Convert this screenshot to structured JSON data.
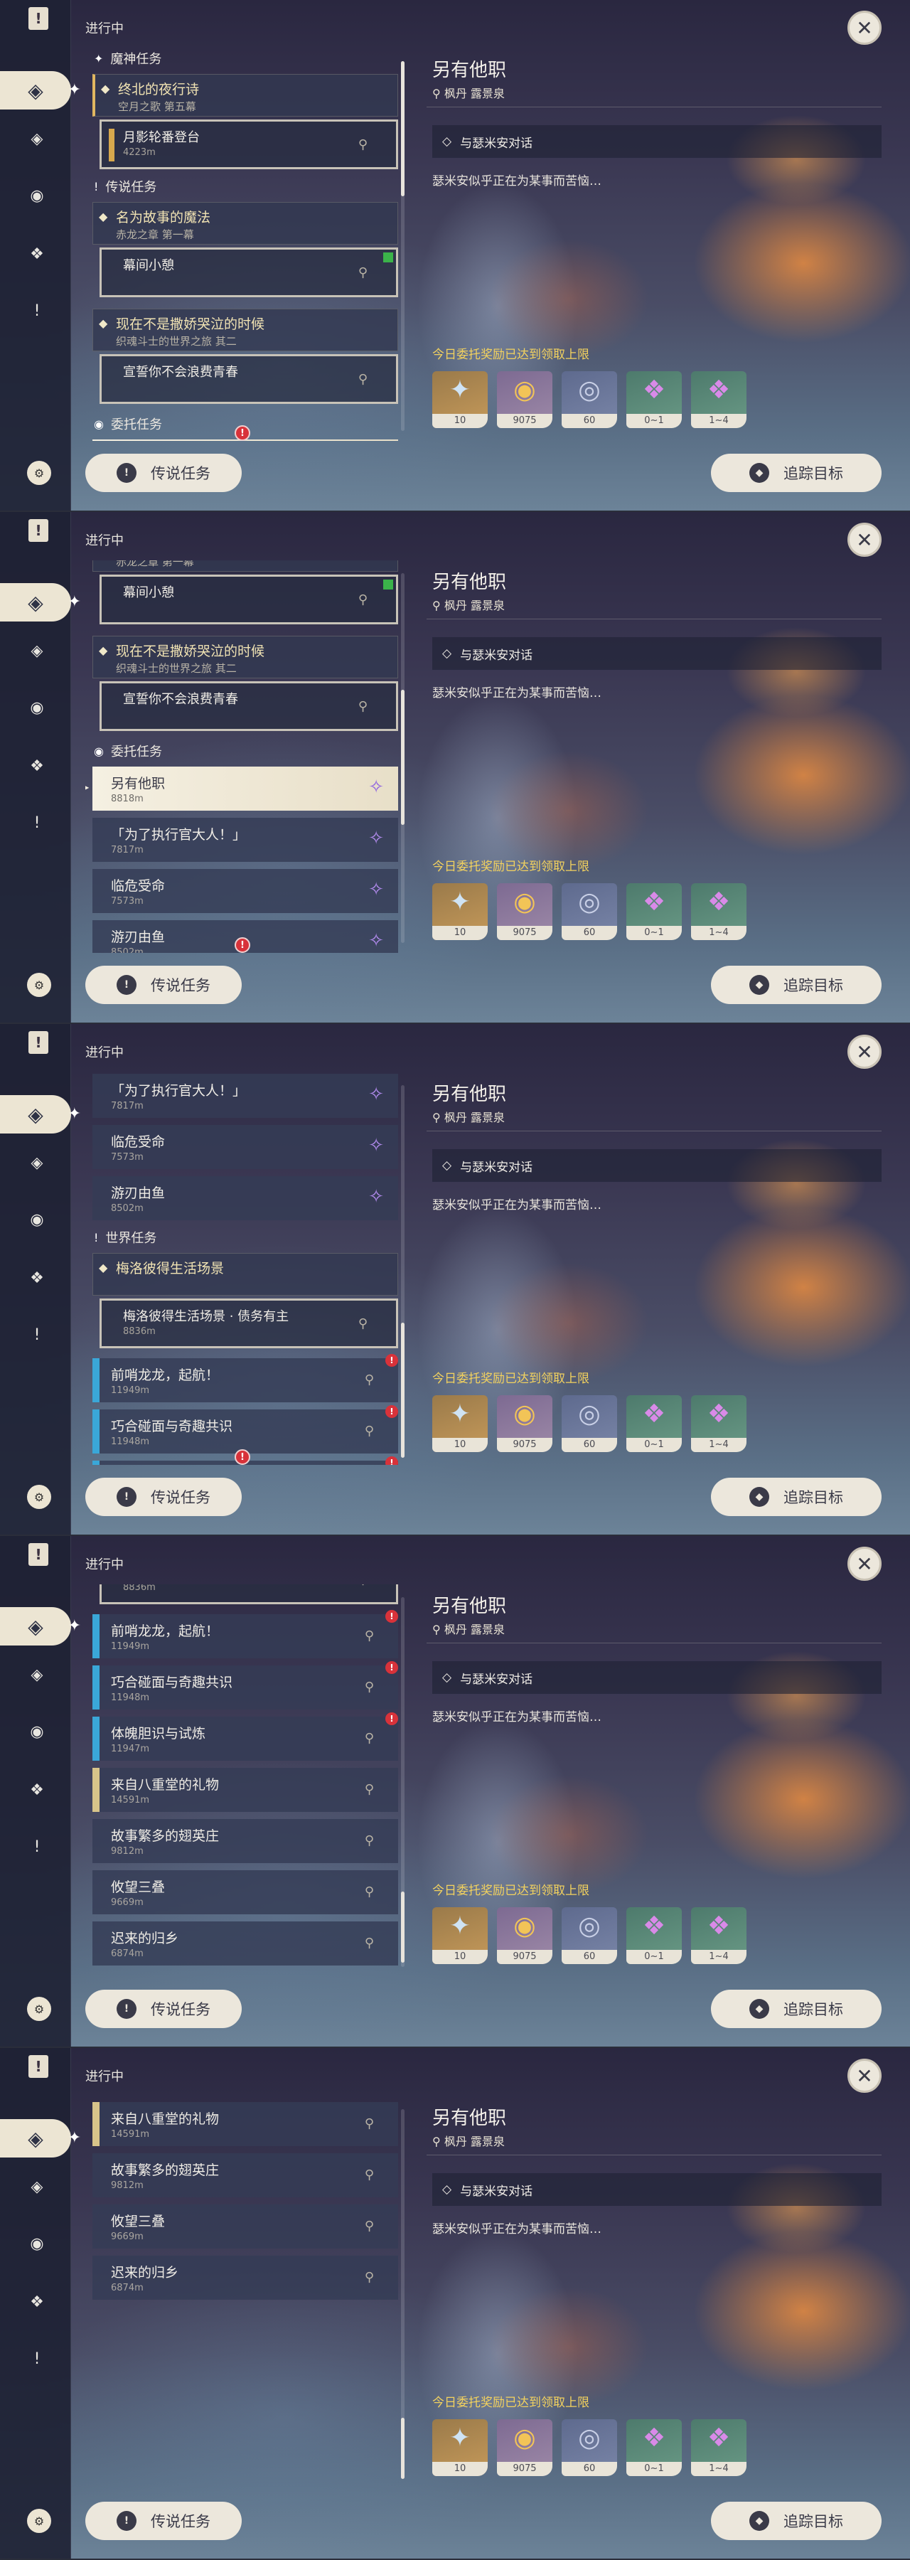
{
  "header": "进行中",
  "close_icon": "close-icon",
  "sections": {
    "archon": "魔神任务",
    "legend": "传说任务",
    "commission": "委托任务",
    "world": "世界任务"
  },
  "quests": {
    "archon_title": "终北的夜行诗",
    "archon_sub": "空月之歌 第五幕",
    "archon_step": "月影轮番登台",
    "archon_step_dist": "4223m",
    "legend1_title": "名为故事的魔法",
    "legend1_sub": "赤龙之章 第一幕",
    "legend1_step": "幕间小憩",
    "legend2_title": "现在不是撒娇哭泣的时候",
    "legend2_sub": "织魂斗士的世界之旅 其二",
    "legend2_step": "宣誓你不会浪费青春",
    "world_title": "梅洛彼得生活场景",
    "world_step": "梅洛彼得生活场景 · 债务有主",
    "world_step_dist": "8836m"
  },
  "commissions": [
    {
      "title": "另有他职",
      "dist": "8818m"
    },
    {
      "title": "「为了执行官大人！」",
      "dist": "7817m"
    },
    {
      "title": "临危受命",
      "dist": "7573m"
    },
    {
      "title": "游刃由鱼",
      "dist": "8502m"
    }
  ],
  "world_quests": [
    {
      "title": "前哨龙龙，起航！",
      "dist": "11949m"
    },
    {
      "title": "巧合碰面与奇趣共识",
      "dist": "11948m"
    },
    {
      "title": "体魄胆识与试炼",
      "dist": "11947m"
    },
    {
      "title": "来自八重堂的礼物",
      "dist": "14591m"
    },
    {
      "title": "故事繁多的翅英庄",
      "dist": "9812m"
    },
    {
      "title": "攸望三叠",
      "dist": "9669m"
    },
    {
      "title": "迟来的归乡",
      "dist": "6874m"
    }
  ],
  "detail": {
    "title": "另有他职",
    "location": "枫丹 露景泉",
    "objective": "与瑟米安对话",
    "description": "瑟米安似乎正在为某事而苦恼…",
    "reward_note": "今日委托奖励已达到领取上限",
    "items": [
      {
        "icon": "adventure-exp-icon",
        "count": "10"
      },
      {
        "icon": "mora-icon",
        "count": "9075"
      },
      {
        "icon": "companionship-exp-icon",
        "count": "60"
      },
      {
        "icon": "crystal-icon",
        "count": "0~1"
      },
      {
        "icon": "crystal-cluster-icon",
        "count": "1~4"
      }
    ]
  },
  "buttons": {
    "legend": "传说任务",
    "track": "追踪目标"
  }
}
